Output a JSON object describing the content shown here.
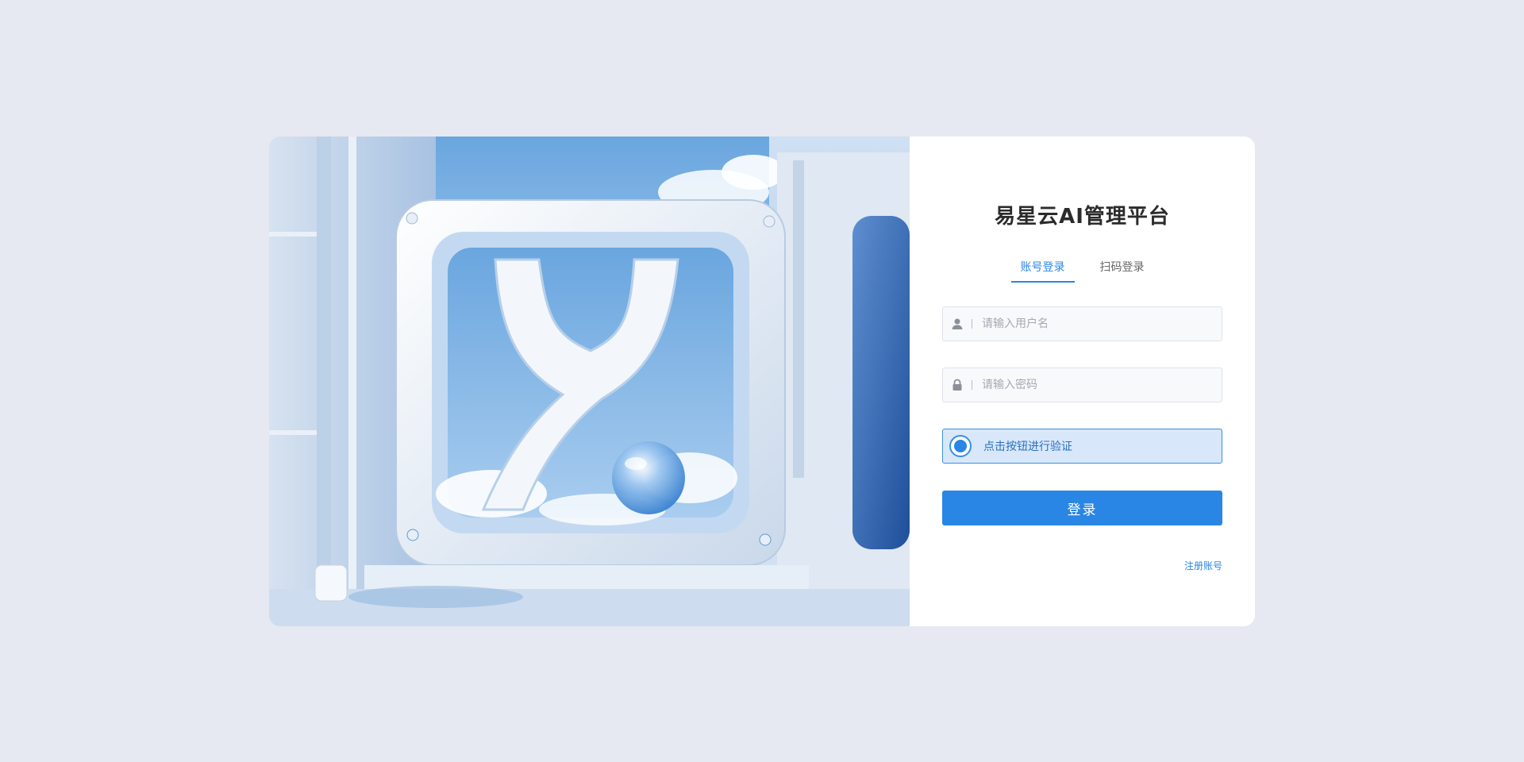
{
  "app": {
    "title": "易星云AI管理平台"
  },
  "tabs": [
    {
      "label": "账号登录",
      "active": true
    },
    {
      "label": "扫码登录",
      "active": false
    }
  ],
  "form": {
    "username_placeholder": "请输入用户名",
    "username_value": "",
    "password_placeholder": "请输入密码",
    "password_value": "",
    "verify_label": "点击按钮进行验证",
    "login_label": "登录",
    "register_label": "注册账号"
  },
  "icons": {
    "username": "user-icon",
    "password": "lock-icon",
    "verify": "radio-dot-icon"
  },
  "colors": {
    "accent": "#2a86e5",
    "background": "#e6e9f1",
    "verify_bg": "#d8e8fa"
  }
}
